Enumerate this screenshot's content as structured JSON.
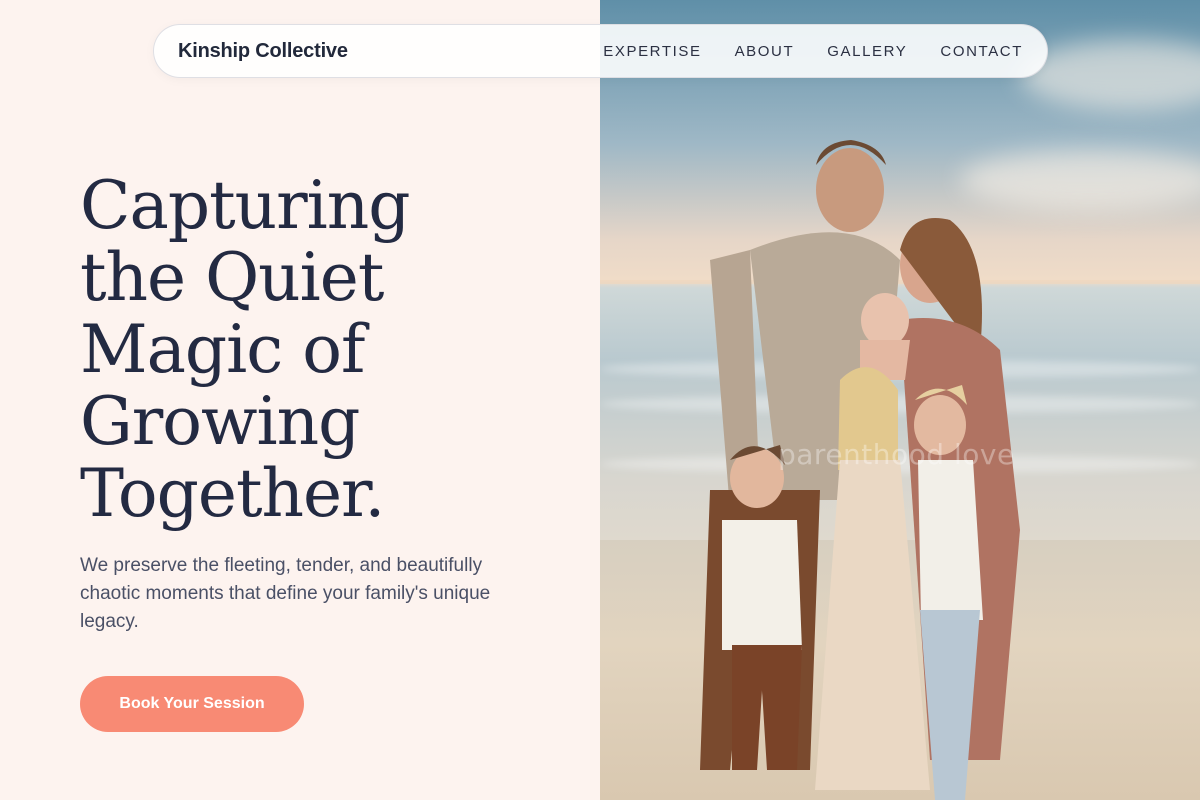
{
  "nav": {
    "brand": "Kinship Collective",
    "links": [
      "EXPERTISE",
      "ABOUT",
      "GALLERY",
      "CONTACT"
    ]
  },
  "hero": {
    "headline_lines": [
      "Capturing",
      "the Quiet",
      "Magic of",
      "Growing",
      "Together."
    ],
    "subtext": "We preserve the fleeting, tender, and beautifully chaotic moments that define your family's unique legacy.",
    "cta_label": "Book Your Session",
    "photo_watermark": "parenthood love"
  },
  "colors": {
    "background": "#fdf3ef",
    "headline": "#232a42",
    "accent": "#f88a74"
  }
}
